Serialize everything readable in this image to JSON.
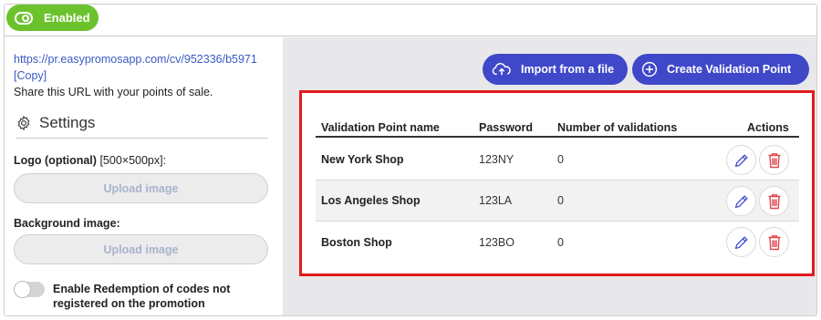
{
  "topbar": {
    "status_label": "Enabled"
  },
  "share": {
    "url": "https://pr.easypromosapp.com/cv/952336/b5971",
    "copy_label": "[Copy]",
    "help": "Share this URL with your points of sale."
  },
  "settings": {
    "title": "Settings",
    "logo_label": "Logo (optional)",
    "logo_hint": "[500×500px]:",
    "logo_button": "Upload image",
    "bg_label": "Background image:",
    "bg_button": "Upload image",
    "redemption_label": "Enable Redemption of codes not registered on the promotion"
  },
  "actions": {
    "import_label": "Import from a file",
    "create_label": "Create Validation Point"
  },
  "table": {
    "headers": [
      "Validation Point name",
      "Password",
      "Number of validations",
      "Actions"
    ],
    "rows": [
      {
        "name": "New York Shop",
        "password": "123NY",
        "validations": "0"
      },
      {
        "name": "Los Angeles Shop",
        "password": "123LA",
        "validations": "0"
      },
      {
        "name": "Boston Shop",
        "password": "123BO",
        "validations": "0"
      }
    ]
  },
  "colors": {
    "enabled_green": "#6cc22c",
    "primary_blue": "#3f48c9",
    "highlight_red": "#e3191b",
    "link_blue": "#3b5bc4"
  },
  "icons": [
    "toggle-icon",
    "gear-icon",
    "cloud-upload-icon",
    "plus-circle-icon",
    "pencil-icon",
    "trash-icon"
  ]
}
